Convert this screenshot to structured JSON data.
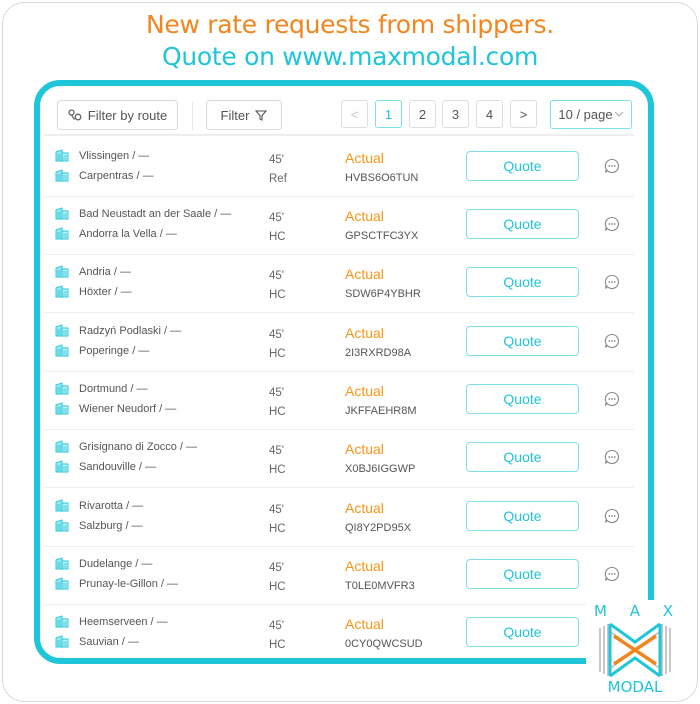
{
  "header": {
    "line1": "New rate requests from shippers.",
    "line2": "Quote on www.maxmodal.com",
    "line1_color": "#f0861d",
    "line2_color": "#1fc5d8"
  },
  "toolbar": {
    "filter_by_route_label": "Filter by route",
    "filter_label": "Filter",
    "route_icon": "route-pin-icon",
    "filter_icon": "funnel-icon"
  },
  "pagination": {
    "prev": "<",
    "next": ">",
    "pages": [
      "1",
      "2",
      "3",
      "4"
    ],
    "current_page": "1",
    "page_size": "10 / page"
  },
  "rows": [
    {
      "origin": "Vlissingen / —",
      "destination": "Carpentras / —",
      "size": "45'",
      "type": "Ref",
      "status": "Actual",
      "code": "HVBS6O6TUN",
      "action": "Quote"
    },
    {
      "origin": "Bad Neustadt an der Saale / —",
      "destination": "Andorra la Vella / —",
      "size": "45'",
      "type": "HC",
      "status": "Actual",
      "code": "GPSCTFC3YX",
      "action": "Quote"
    },
    {
      "origin": "Andria / —",
      "destination": "Höxter / —",
      "size": "45'",
      "type": "HC",
      "status": "Actual",
      "code": "SDW6P4YBHR",
      "action": "Quote"
    },
    {
      "origin": "Radzyń Podlaski / —",
      "destination": "Poperinge / —",
      "size": "45'",
      "type": "HC",
      "status": "Actual",
      "code": "2I3RXRD98A",
      "action": "Quote"
    },
    {
      "origin": "Dortmund / —",
      "destination": "Wiener Neudorf / —",
      "size": "45'",
      "type": "HC",
      "status": "Actual",
      "code": "JKFFAEHR8M",
      "action": "Quote"
    },
    {
      "origin": "Grisignano di Zocco / —",
      "destination": "Sandouville / —",
      "size": "45'",
      "type": "HC",
      "status": "Actual",
      "code": "X0BJ6IGGWP",
      "action": "Quote"
    },
    {
      "origin": "Rivarotta / —",
      "destination": "Salzburg / —",
      "size": "45'",
      "type": "HC",
      "status": "Actual",
      "code": "QI8Y2PD95X",
      "action": "Quote"
    },
    {
      "origin": "Dudelange / —",
      "destination": "Prunay-le-Gillon / —",
      "size": "45'",
      "type": "HC",
      "status": "Actual",
      "code": "T0LE0MVFR3",
      "action": "Quote"
    },
    {
      "origin": "Heemserveen / —",
      "destination": "Sauvian / —",
      "size": "45'",
      "type": "HC",
      "status": "Actual",
      "code": "0CY0QWCSUD",
      "action": "Quote"
    }
  ],
  "logo": {
    "top": "M A X",
    "bottom": "MODAL"
  },
  "colors": {
    "accent": "#1fc5d8",
    "status": "#f79516"
  }
}
